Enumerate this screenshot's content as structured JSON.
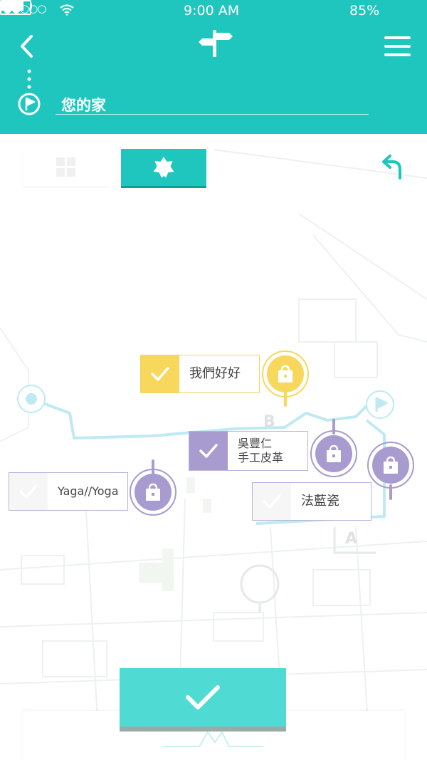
{
  "status_bar": {
    "signal": "●●○○○",
    "time": "9:00 AM",
    "battery": "85%",
    "battery_level": 0.85
  },
  "header": {
    "destination": "您的家"
  },
  "map": {
    "marker_b": "B",
    "marker_a": "A"
  },
  "pins": [
    {
      "label": "我們好好",
      "checked": true,
      "color": "#f7d85c"
    },
    {
      "label": "吳豐仁",
      "sub": "手工皮革",
      "checked": true,
      "color": "#a79bd0"
    },
    {
      "label": "Yaga//Yoga",
      "checked": false,
      "color": "#a79bd0"
    },
    {
      "label": "法藍瓷",
      "checked": false,
      "color": "#a79bd0"
    }
  ],
  "colors": {
    "primary": "#1fc6be",
    "confirm": "#4fdbd3",
    "purple": "#a79bd0",
    "yellow": "#f7d85c"
  }
}
